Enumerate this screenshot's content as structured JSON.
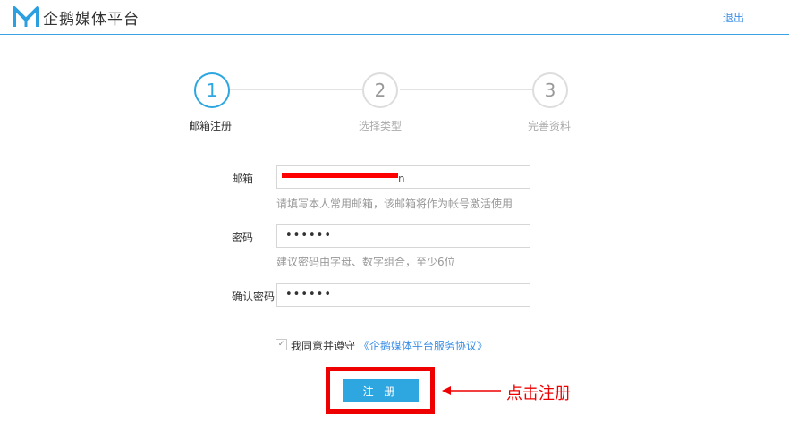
{
  "header": {
    "brand": "企鹅媒体平台",
    "logout": "退出",
    "logo_icon": "penguin-media-logo-icon",
    "accent_color": "#3aa3e3"
  },
  "steps": [
    {
      "number": "1",
      "label": "邮箱注册",
      "active": true
    },
    {
      "number": "2",
      "label": "选择类型",
      "active": false
    },
    {
      "number": "3",
      "label": "完善资料",
      "active": false
    }
  ],
  "form": {
    "email": {
      "label": "邮箱",
      "value_visible_tail": "n",
      "hint": "请填写本人常用邮箱，该邮箱将作为帐号激活使用"
    },
    "password": {
      "label": "密码",
      "value": "••••••",
      "hint": "建议密码由字母、数字组合，至少6位"
    },
    "confirm": {
      "label": "确认密码",
      "value": "••••••"
    },
    "agree": {
      "checked": true,
      "text": "我同意并遵守",
      "link": "《企鹅媒体平台服务协议》"
    },
    "submit": "注 册"
  },
  "annotation": {
    "text": "点击注册",
    "color": "#ee0000",
    "arrow_icon": "left-arrow-icon"
  }
}
